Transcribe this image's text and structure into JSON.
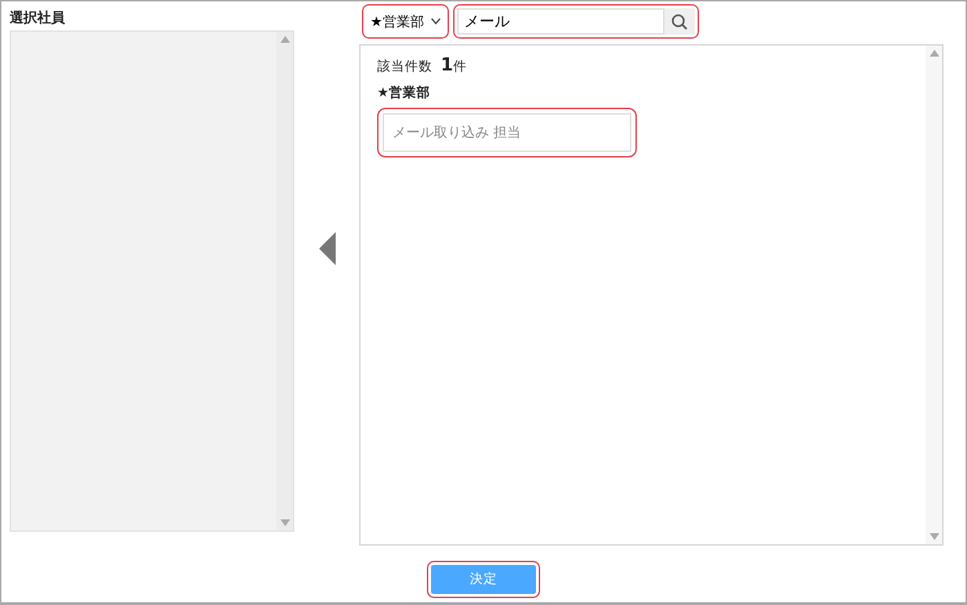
{
  "selected_panel": {
    "title": "選択社員"
  },
  "department_select": {
    "value": "★営業部",
    "highlighted": true
  },
  "search": {
    "value": "メール",
    "highlighted": true
  },
  "results": {
    "count_label": "該当件数",
    "count": "1",
    "count_unit": "件",
    "groups": [
      {
        "name": "★営業部",
        "items": [
          {
            "label": "メール取り込み 担当",
            "highlighted": true
          }
        ]
      }
    ]
  },
  "confirm_button": {
    "label": "決定",
    "highlighted": true
  }
}
